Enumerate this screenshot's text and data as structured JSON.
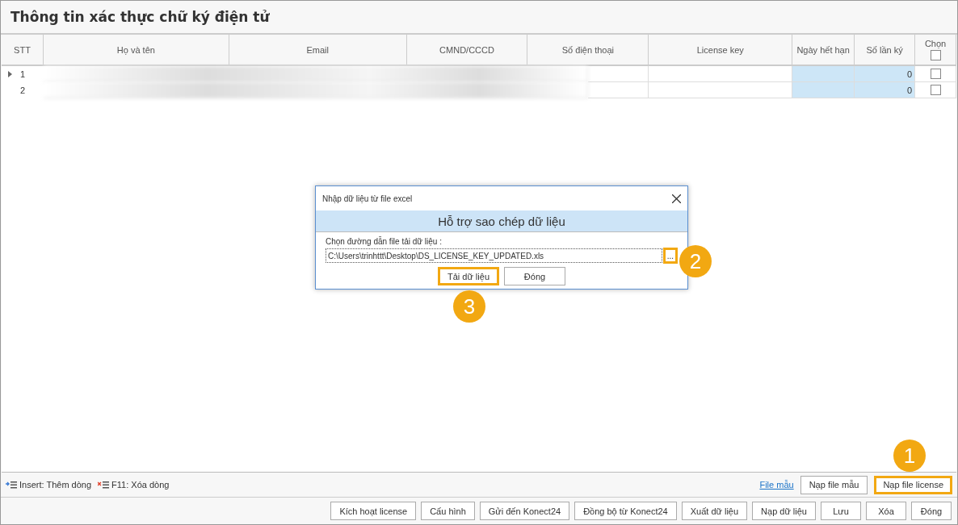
{
  "title": "Thông tin xác thực chữ ký điện tử",
  "table": {
    "columns": [
      {
        "label": "STT"
      },
      {
        "label": "Họ và tên"
      },
      {
        "label": "Email"
      },
      {
        "label": "CMND/CCCD"
      },
      {
        "label": "Số điện thoại"
      },
      {
        "label": "License key"
      },
      {
        "label": "Ngày hết hạn"
      },
      {
        "label": "Số lần ký"
      },
      {
        "label": "Chọn"
      }
    ],
    "header_checkbox": {
      "checked": false
    },
    "rows": [
      {
        "stt": "1",
        "current": true,
        "count": "0",
        "checked": false
      },
      {
        "stt": "2",
        "current": false,
        "count": "0",
        "checked": false
      }
    ]
  },
  "hints": [
    {
      "kind": "insert",
      "label": "Insert: Thêm dòng"
    },
    {
      "kind": "delete",
      "label": "F11: Xóa dòng"
    }
  ],
  "template_link": "File mẫu",
  "toolbar_buttons": [
    {
      "label": "Nạp file mẫu",
      "highlighted": false
    },
    {
      "label": "Nạp file license",
      "highlighted": true
    }
  ],
  "bottom_buttons": [
    "Kích hoạt license",
    "Cấu hình",
    "Gửi đến Konect24",
    "Đồng bộ từ Konect24",
    "Xuất dữ liệu",
    "Nạp dữ liệu",
    "Lưu",
    "Xóa",
    "Đóng"
  ],
  "dialog": {
    "title": "Nhập dữ liệu từ file excel",
    "heading": "Hỗ trợ sao chép dữ liệu",
    "field_label": "Chọn đường dẫn file tải dữ liệu :",
    "path": "C:\\Users\\trinhttt\\Desktop\\DS_LICENSE_KEY_UPDATED.xls",
    "browse": {
      "label": "...",
      "highlighted": true
    },
    "buttons": [
      {
        "label": "Tải dữ liệu",
        "highlighted": true
      },
      {
        "label": "Đóng",
        "highlighted": false
      }
    ]
  },
  "badges": [
    "1",
    "2",
    "3"
  ]
}
